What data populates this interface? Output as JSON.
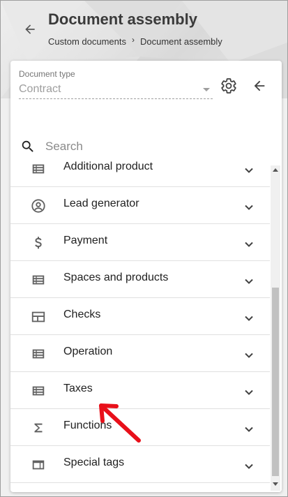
{
  "header": {
    "title": "Document assembly",
    "breadcrumb": [
      "Custom documents",
      "Document assembly"
    ],
    "breadcrumb_separator": "›"
  },
  "document_type": {
    "label": "Document type",
    "value": "Contract"
  },
  "search": {
    "placeholder": "Search"
  },
  "sections": [
    {
      "label": "Additional product",
      "icon": "table-rows-icon"
    },
    {
      "label": "Lead generator",
      "icon": "account-circle-icon"
    },
    {
      "label": "Payment",
      "icon": "dollar-icon"
    },
    {
      "label": "Spaces and products",
      "icon": "table-rows-icon"
    },
    {
      "label": "Checks",
      "icon": "web-layout-icon"
    },
    {
      "label": "Operation",
      "icon": "table-rows-icon"
    },
    {
      "label": "Taxes",
      "icon": "table-rows-icon"
    },
    {
      "label": "Functions",
      "icon": "sigma-icon"
    },
    {
      "label": "Special tags",
      "icon": "web-asset-icon"
    }
  ],
  "colors": {
    "icon": "#616161",
    "annotation_arrow": "#e8101a",
    "title": "#3a3a3a"
  }
}
